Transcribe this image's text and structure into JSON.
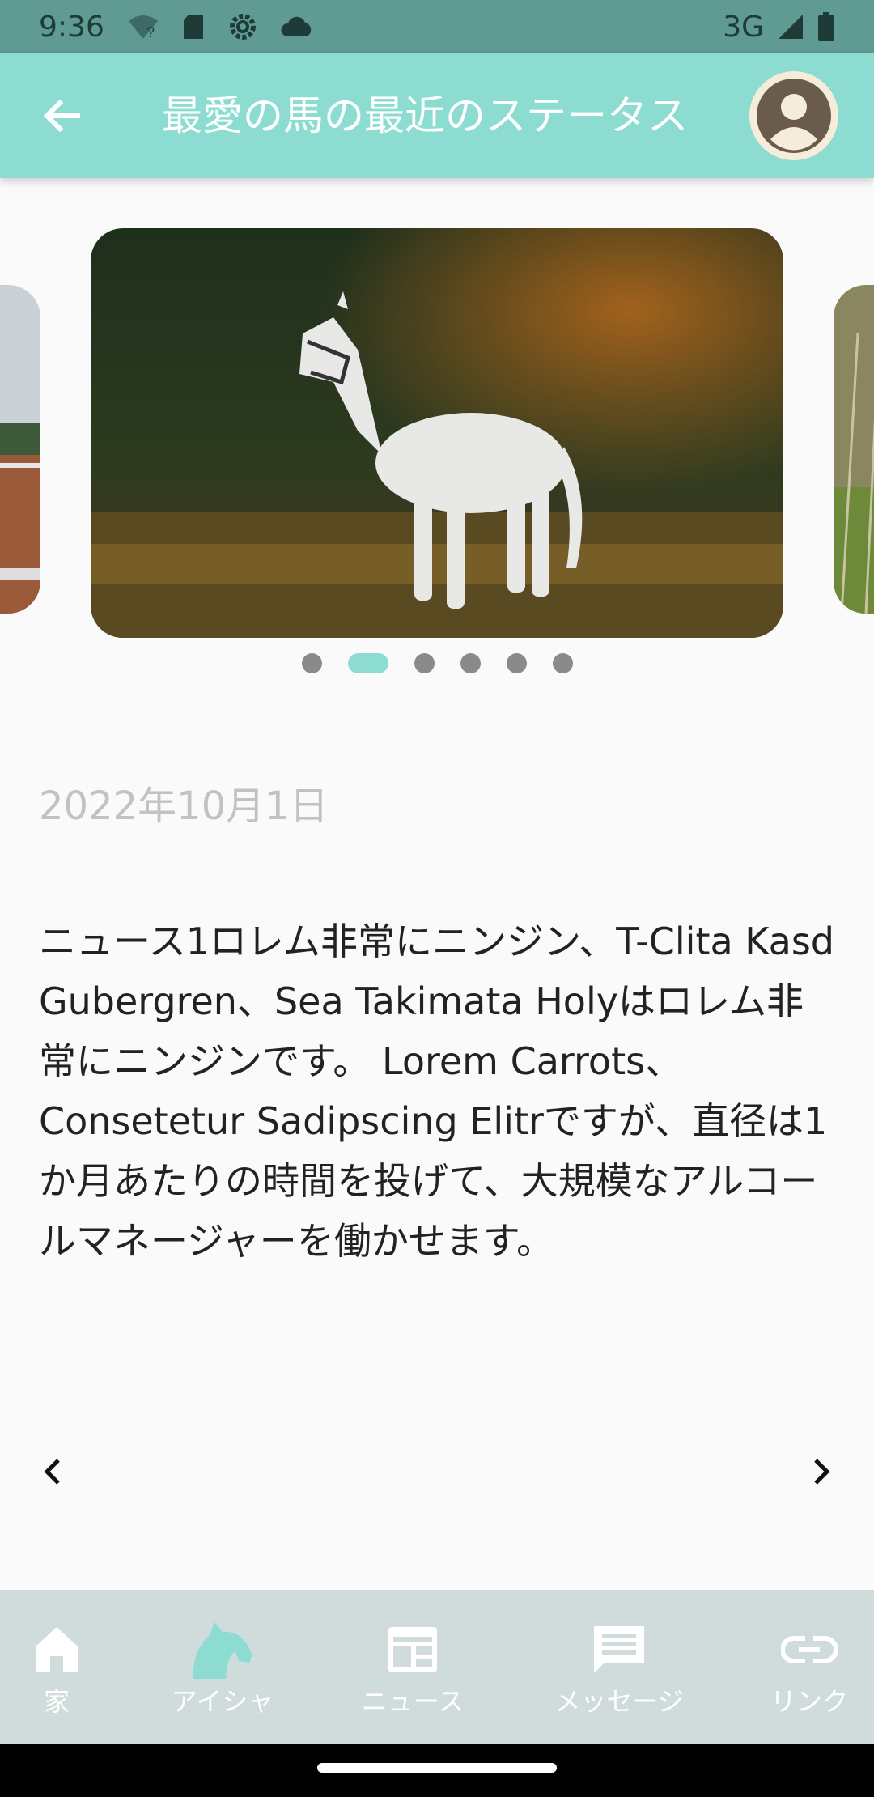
{
  "status_bar": {
    "time": "9:36",
    "network": "3G",
    "icons": [
      "wifi-question-icon",
      "sd-card-icon",
      "settings-gear-icon",
      "cloud-icon",
      "signal-icon",
      "battery-icon"
    ]
  },
  "app_bar": {
    "title": "最愛の馬の最近のステータス",
    "back_icon": "arrow-left-icon",
    "avatar_icon": "account-circle-icon"
  },
  "carousel": {
    "current_index": 1,
    "total": 6,
    "slides": [
      "paddock-horses-photo",
      "white-horse-photo",
      "grass-field-photo"
    ]
  },
  "post": {
    "date": "2022年10月1日",
    "body": "ニュース1ロレム非常にニンジン、T-Clita Kasd Gubergren、Sea Takimata Holyはロレム非常にニンジンです。 Lorem Carrots、Consetetur Sadipscing Elitrですが、直径は1か月あたりの時間を投げて、大規模なアルコールマネージャーを働かせます。"
  },
  "pager": {
    "prev_icon": "chevron-left-icon",
    "next_icon": "chevron-right-icon"
  },
  "bottom_nav": {
    "active_index": 1,
    "items": [
      {
        "label": "家",
        "icon": "home-icon"
      },
      {
        "label": "アイシャ",
        "icon": "horse-head-icon"
      },
      {
        "label": "ニュース",
        "icon": "newspaper-icon"
      },
      {
        "label": "メッセージ",
        "icon": "message-icon"
      },
      {
        "label": "リンク",
        "icon": "link-icon"
      }
    ]
  },
  "colors": {
    "accent": "#8cdcd1",
    "status_bar": "#5f9a93",
    "bottom_nav": "#cfdcdb",
    "inactive_dot": "#8a8a8a",
    "date_text": "#c2c2c2"
  }
}
